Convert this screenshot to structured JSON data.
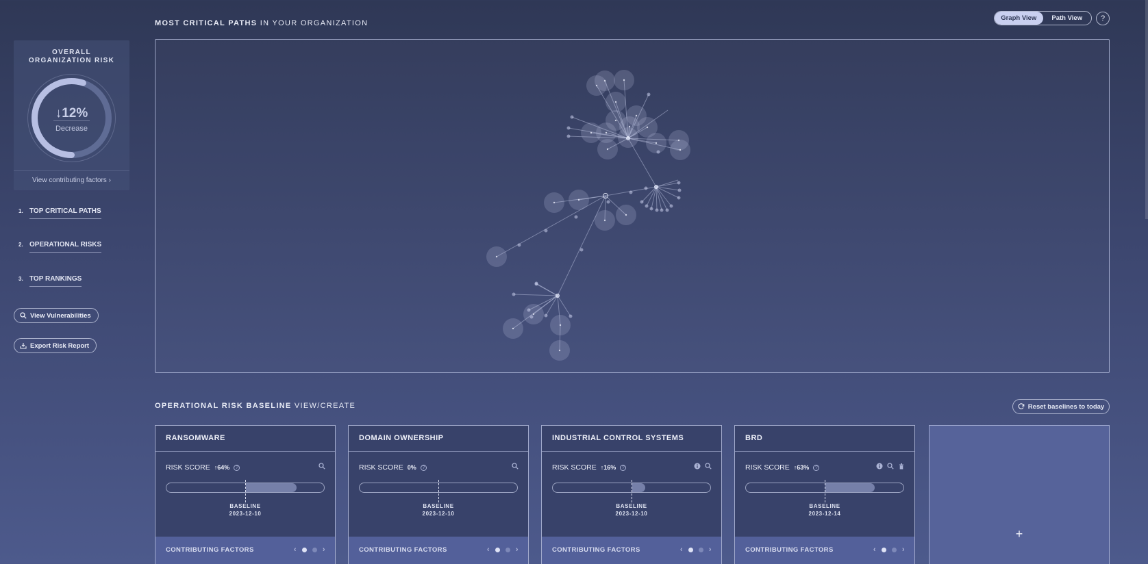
{
  "sidebar": {
    "risk_card": {
      "title_line1": "OVERALL",
      "title_line2": "ORGANIZATION RISK",
      "value": "12%",
      "trend": "down",
      "fraction": 0.55,
      "label": "Decrease",
      "link": "View contributing factors"
    },
    "nav": [
      {
        "num": "1.",
        "label": "TOP CRITICAL PATHS"
      },
      {
        "num": "2.",
        "label": "OPERATIONAL RISKS"
      },
      {
        "num": "3.",
        "label": "TOP RANKINGS"
      }
    ],
    "view_vulnerabilities": "View Vulnerabilities",
    "export_report": "Export Risk Report"
  },
  "graph": {
    "title_bold": "MOST CRITICAL PATHS",
    "title_rest": "IN YOUR ORGANIZATION",
    "view_toggle": {
      "graph": "Graph View",
      "path": "Path View",
      "selected": "graph"
    },
    "help": "?"
  },
  "baseline": {
    "title_bold": "OPERATIONAL RISK BASELINE",
    "title_rest": "VIEW/CREATE",
    "reset_button": "Reset baselines to today",
    "score_label": "RISK SCORE",
    "baseline_label": "BASELINE",
    "footer_label": "CONTRIBUTING FACTORS",
    "cards": [
      {
        "name": "RANSOMWARE",
        "score": "64%",
        "trend": "up",
        "baseline_pct": 0.5,
        "fill_pct": 0.82,
        "baseline_date": "2023-12-10",
        "icons": [
          "search-icon"
        ]
      },
      {
        "name": "DOMAIN OWNERSHIP",
        "score": "0%",
        "trend": "none",
        "baseline_pct": 0.5,
        "fill_pct": 0.5,
        "baseline_date": "2023-12-10",
        "icons": [
          "search-icon"
        ]
      },
      {
        "name": "INDUSTRIAL CONTROL SYSTEMS",
        "score": "16%",
        "trend": "up",
        "baseline_pct": 0.5,
        "fill_pct": 0.58,
        "baseline_date": "2023-12-10",
        "icons": [
          "info-icon",
          "search-icon"
        ]
      },
      {
        "name": "BRD",
        "score": "63%",
        "trend": "up",
        "baseline_pct": 0.5,
        "fill_pct": 0.81,
        "baseline_date": "2023-12-14",
        "icons": [
          "info-icon",
          "search-icon",
          "trash-icon"
        ]
      }
    ],
    "add_card": "+"
  }
}
